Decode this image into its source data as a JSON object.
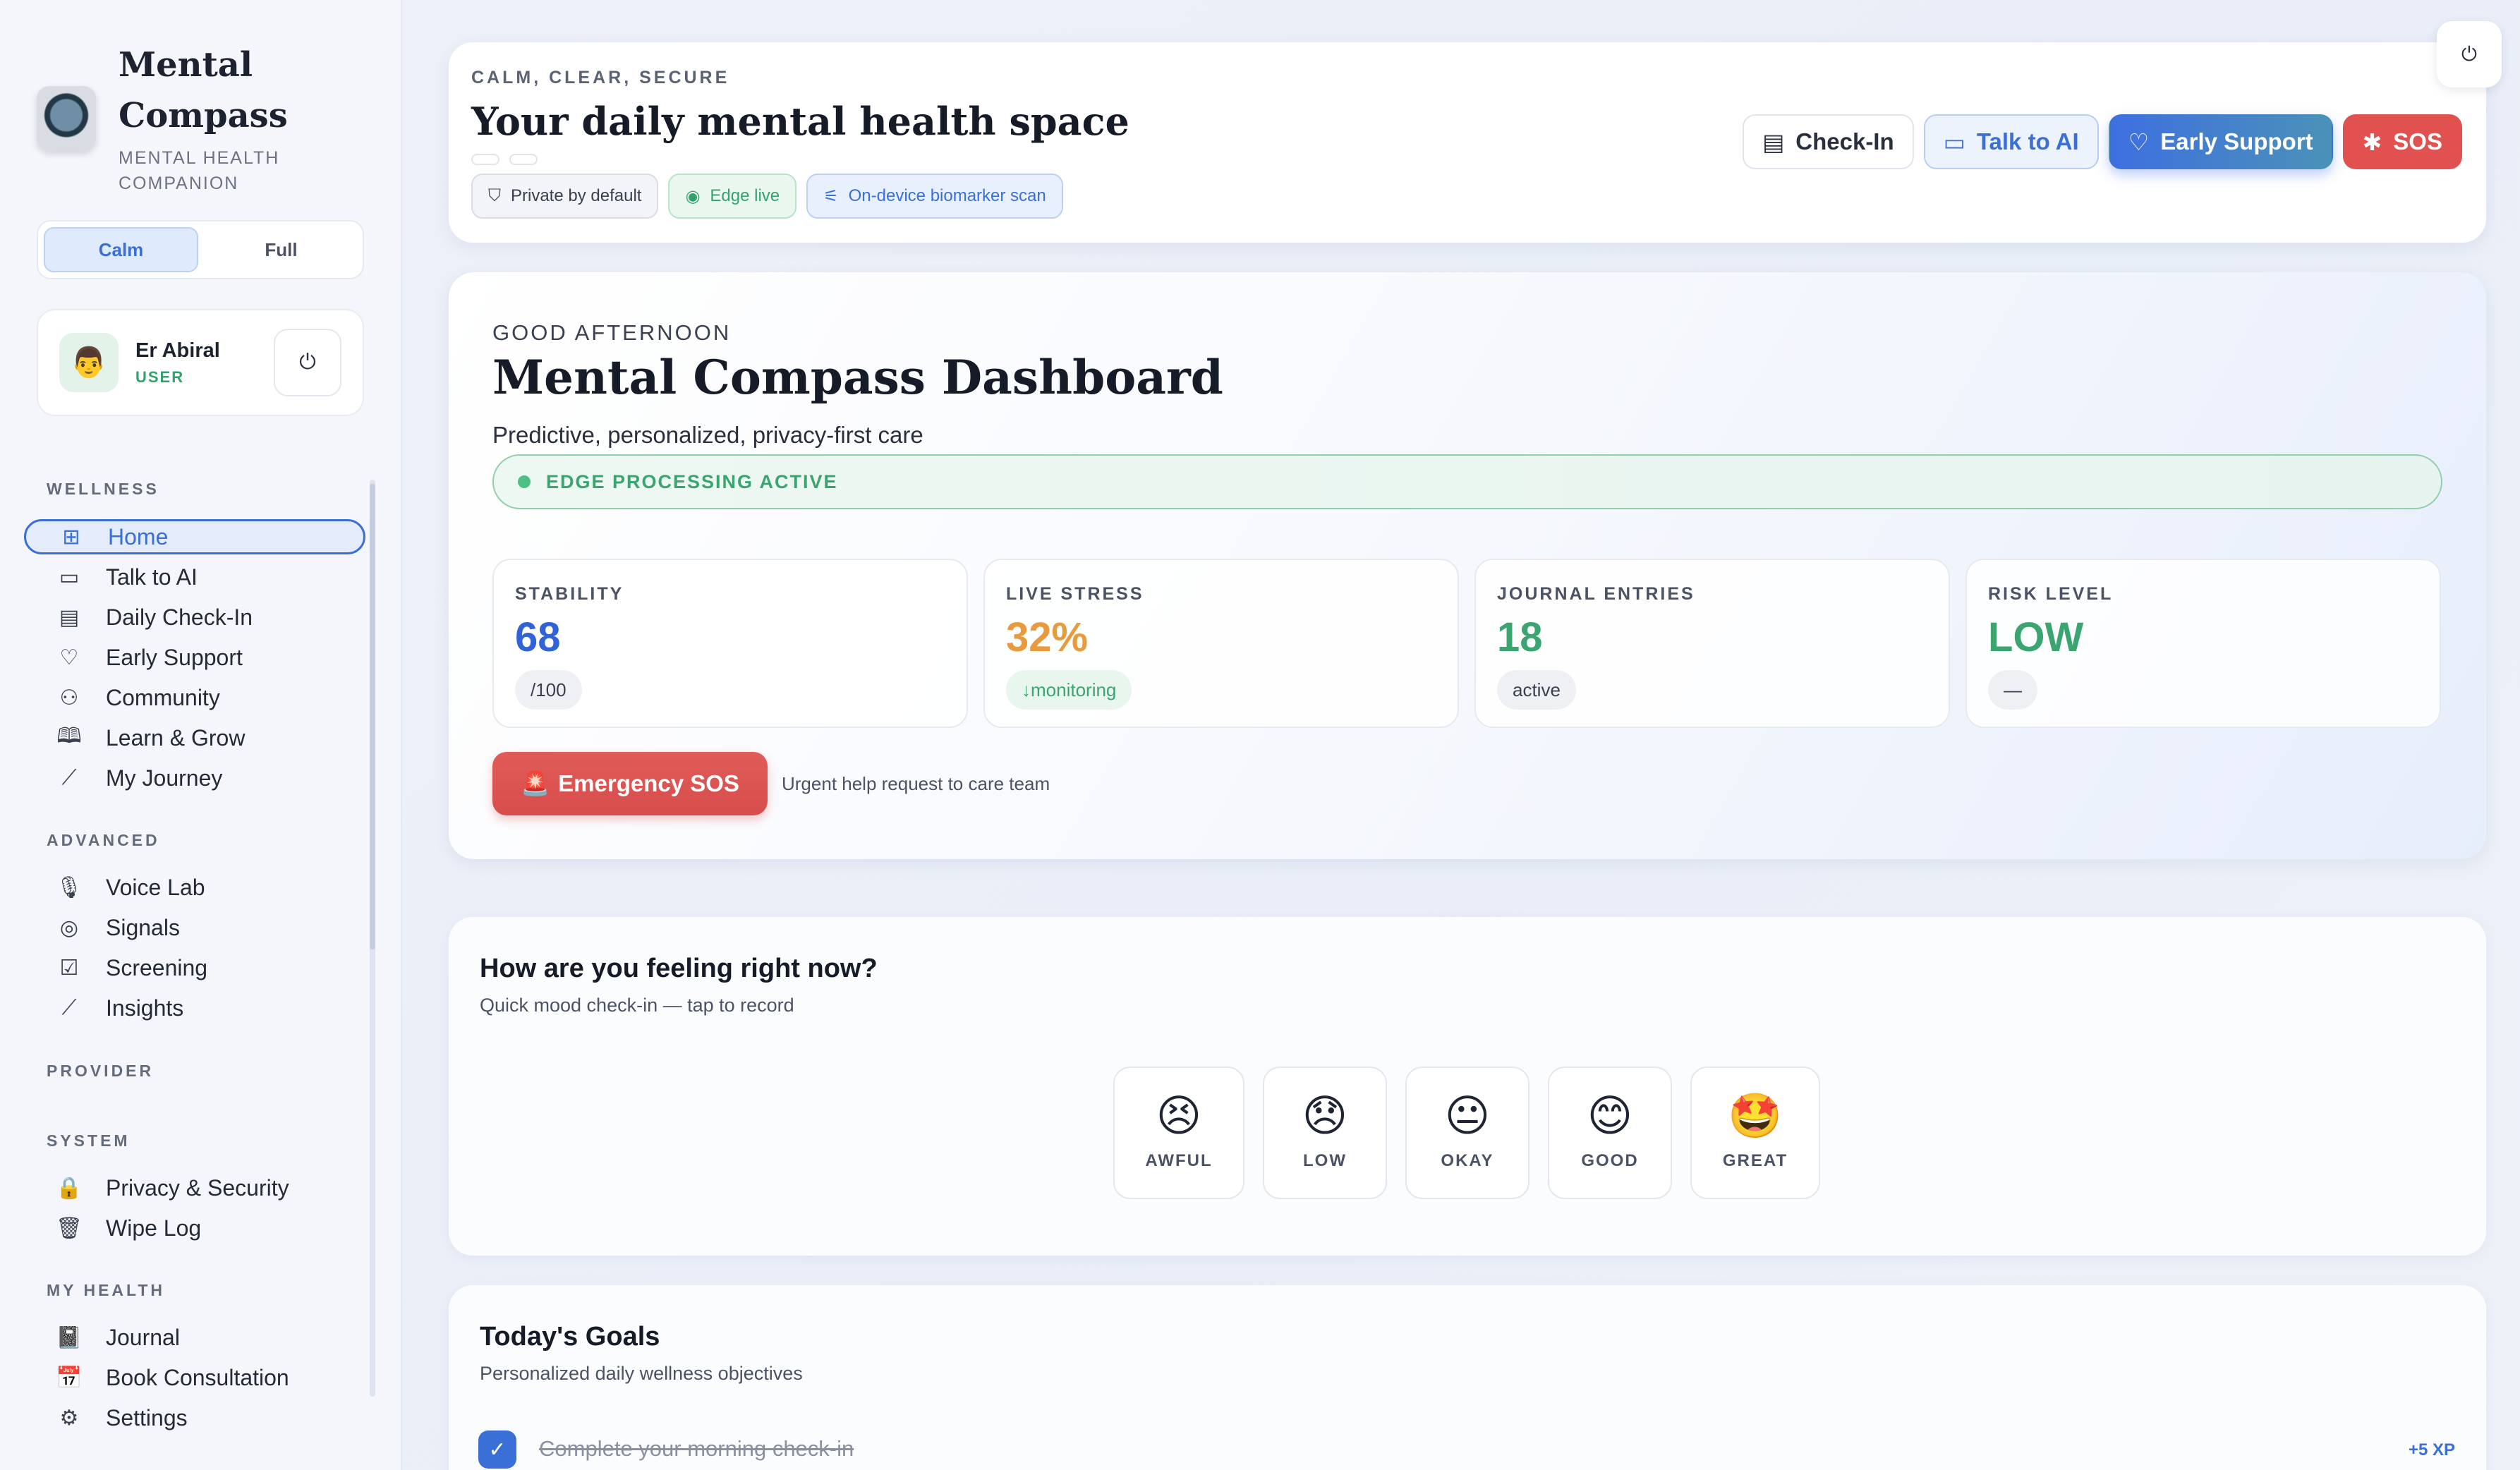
{
  "sidebar": {
    "brand": {
      "title_line1": "Mental",
      "title_line2": "Compass",
      "subtitle_line1": "MENTAL HEALTH",
      "subtitle_line2": "COMPANION"
    },
    "mode_toggle": {
      "options": [
        "Calm",
        "Full"
      ],
      "selected": "Calm"
    },
    "user": {
      "avatar": "👨",
      "name": "Er Abiral",
      "role": "USER",
      "power_icon": "⏻"
    },
    "sections": {
      "wellness": "WELLNESS",
      "advanced": "ADVANCED",
      "provider": "PROVIDER",
      "system": "SYSTEM",
      "my_health": "MY HEALTH"
    },
    "wellness_items": [
      {
        "label": "Home",
        "icon": "grid-icon",
        "glyph": "⊞"
      },
      {
        "label": "Talk to AI",
        "icon": "chat-icon",
        "glyph": "▭"
      },
      {
        "label": "Daily Check-In",
        "icon": "calendar-icon",
        "glyph": "▤"
      },
      {
        "label": "Early Support",
        "icon": "heart-icon",
        "glyph": "♡"
      },
      {
        "label": "Community",
        "icon": "people-icon",
        "glyph": "⚇"
      },
      {
        "label": "Learn & Grow",
        "icon": "book-icon",
        "glyph": "🕮"
      },
      {
        "label": "My Journey",
        "icon": "trend-icon",
        "glyph": "⟋"
      }
    ],
    "advanced_items": [
      {
        "label": "Voice Lab",
        "icon": "microphone-icon",
        "glyph": "🎙"
      },
      {
        "label": "Signals",
        "icon": "signal-icon",
        "glyph": "◎"
      },
      {
        "label": "Screening",
        "icon": "checklist-icon",
        "glyph": "☑"
      },
      {
        "label": "Insights",
        "icon": "insights-icon",
        "glyph": "⟋"
      }
    ],
    "system_items": [
      {
        "label": "Privacy & Security",
        "icon": "lock-icon",
        "glyph": "🔒"
      },
      {
        "label": "Wipe Log",
        "icon": "trash-icon",
        "glyph": "🗑"
      }
    ],
    "health_items": [
      {
        "label": "Journal",
        "icon": "journal-icon",
        "glyph": "📓"
      },
      {
        "label": "Book Consultation",
        "icon": "calendar-date-icon",
        "glyph": "📅"
      },
      {
        "label": "Settings",
        "icon": "gear-icon",
        "glyph": "⚙"
      }
    ]
  },
  "header": {
    "eyebrow": "CALM, CLEAR, SECURE",
    "title": "Your daily mental health space",
    "pills": [
      {
        "label": "Private by default",
        "icon": "shield-icon",
        "glyph": "⛉"
      },
      {
        "label": "Edge live",
        "icon": "live-dot-icon",
        "glyph": "◉"
      },
      {
        "label": "On-device biomarker scan",
        "icon": "scan-icon",
        "glyph": "⚟"
      }
    ],
    "actions": [
      {
        "label": "Check-In",
        "icon": "calendar-icon",
        "glyph": "▤"
      },
      {
        "label": "Talk to AI",
        "icon": "chat-icon",
        "glyph": "▭"
      },
      {
        "label": "Early Support",
        "icon": "heart-icon",
        "glyph": "♡"
      },
      {
        "label": "SOS",
        "icon": "asterisk-icon",
        "glyph": "✱"
      }
    ],
    "corner_power": "⏻"
  },
  "dashboard": {
    "greeting": "GOOD AFTERNOON",
    "title": "Mental Compass Dashboard",
    "subtitle": "Predictive, personalized, privacy-first care",
    "edge_status": "EDGE PROCESSING ACTIVE",
    "stats": [
      {
        "label": "STABILITY",
        "value": "68",
        "chip": "/100",
        "color": "#2f63d6"
      },
      {
        "label": "LIVE STRESS",
        "value": "32%",
        "chip": "↓monitoring",
        "color": "#e99a3c"
      },
      {
        "label": "JOURNAL ENTRIES",
        "value": "18",
        "chip": "active",
        "color": "#3aa56f"
      },
      {
        "label": "RISK LEVEL",
        "value": "LOW",
        "chip": "—",
        "color": "#3aa56f"
      }
    ],
    "sos_button": {
      "label": "Emergency SOS",
      "icon": "siren-icon",
      "glyph": "🚨"
    },
    "sos_note": "Urgent help request to care team"
  },
  "mood": {
    "title": "How are you feeling right now?",
    "subtitle": "Quick mood check-in — tap to record",
    "options": [
      {
        "label": "AWFUL",
        "emoji": "😣"
      },
      {
        "label": "LOW",
        "emoji": "😞"
      },
      {
        "label": "OKAY",
        "emoji": "😐"
      },
      {
        "label": "GOOD",
        "emoji": "😊"
      },
      {
        "label": "GREAT",
        "emoji": "🤩"
      }
    ]
  },
  "goals": {
    "title": "Today's Goals",
    "subtitle": "Personalized daily wellness objectives",
    "items": [
      {
        "label": "Complete your morning check-in",
        "xp": "+5 XP",
        "done": true,
        "check": "✓"
      }
    ]
  },
  "colors": {
    "accent": "#3a6fd8",
    "success": "#3aa56f",
    "warning": "#e99a3c",
    "danger": "#e0514f"
  }
}
